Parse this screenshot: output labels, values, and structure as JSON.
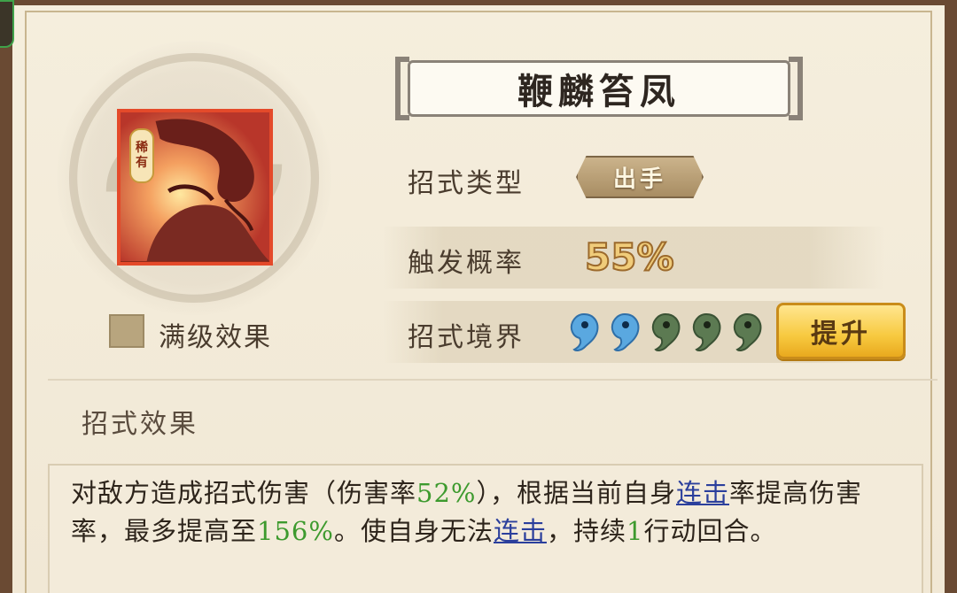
{
  "skill": {
    "name": "鞭麟笞凤",
    "rarity_tag": [
      "稀",
      "有"
    ],
    "max_level_label": "满级效果"
  },
  "stats": {
    "type_label": "招式类型",
    "type_value": "出手",
    "rate_label": "触发概率",
    "rate_value": "55%",
    "realm_label": "招式境界",
    "realm_filled": 2,
    "realm_total": 5,
    "upgrade_label": "提升"
  },
  "effect": {
    "heading": "招式效果",
    "p1": "对敌方造成招式伤害（伤害率",
    "v1": "52%",
    "p2": "），根据当前自身",
    "link1": "连击",
    "p3": "率提高伤害率，最多提高至",
    "v2": "156%",
    "p4": "。使自身无法",
    "link2": "连击",
    "p5": "，持续",
    "v3": "1",
    "p6": "行动回合。"
  },
  "colors": {
    "highlight_green": "#3d9a2e",
    "link_blue": "#2b3f9c",
    "orb_active": "#5aa8e0",
    "orb_inactive": "#5c7a52",
    "icon_border": "#e44a2a"
  }
}
